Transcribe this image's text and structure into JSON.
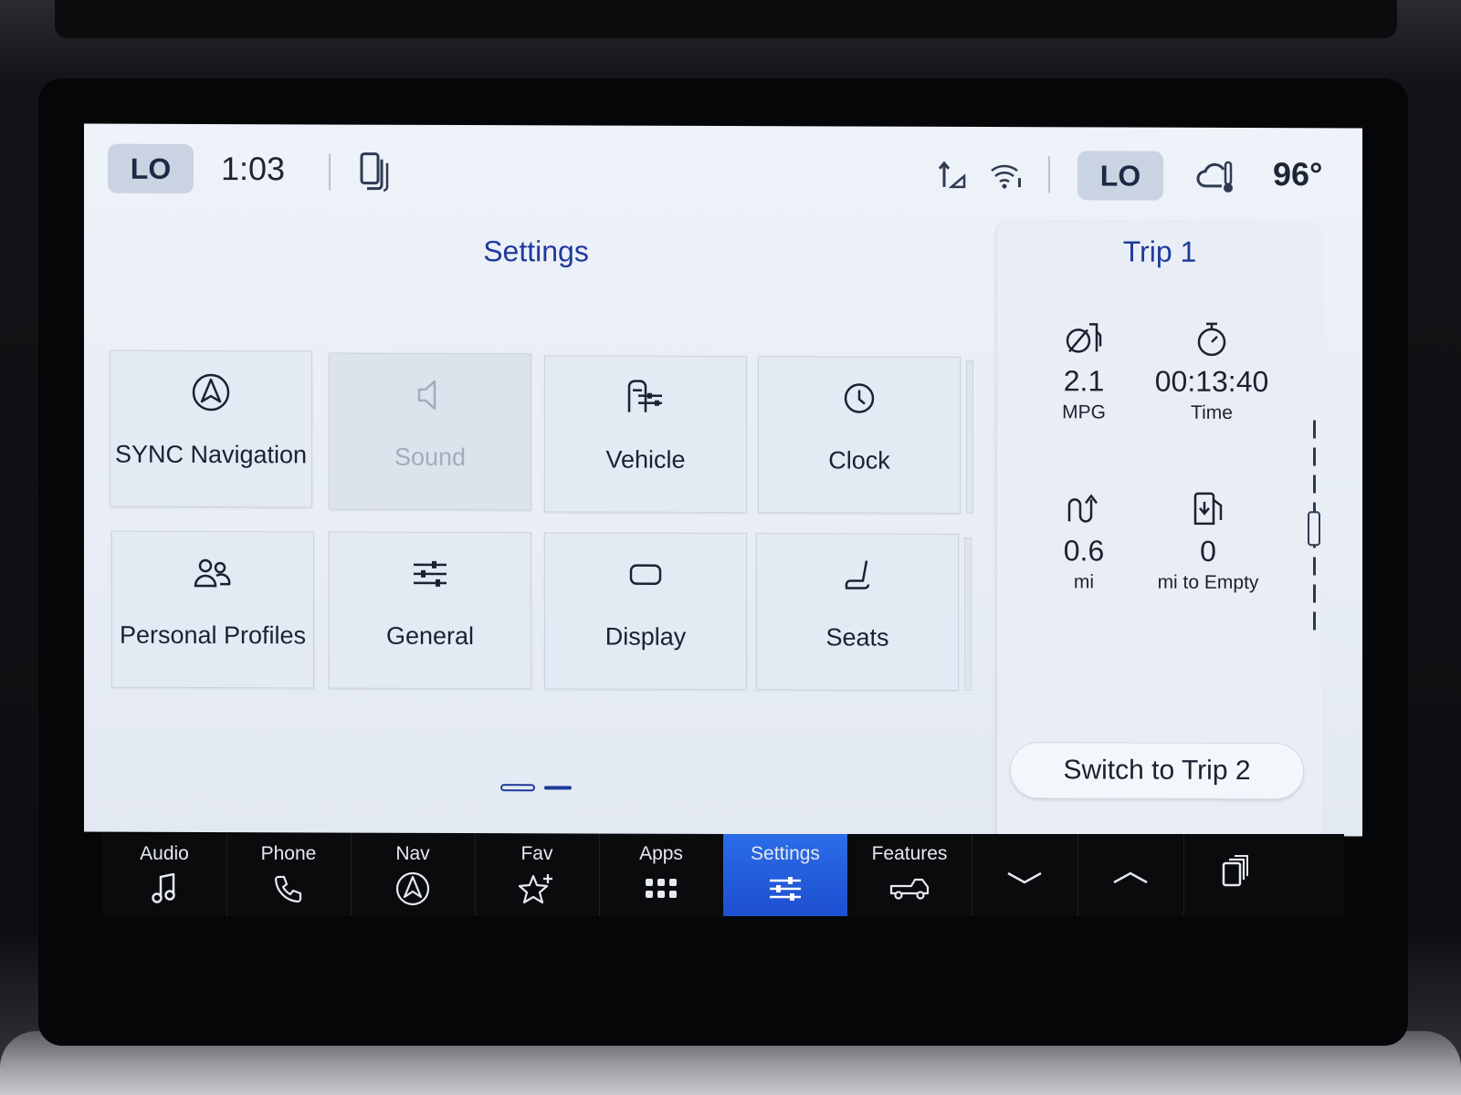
{
  "status_bar": {
    "left_temp": "LO",
    "time": "1:03",
    "right_temp": "LO",
    "outside_temp": "96°"
  },
  "page": {
    "title": "Settings"
  },
  "tiles": [
    {
      "label": "SYNC Navigation",
      "icon": "navigation-icon",
      "enabled": true
    },
    {
      "label": "Sound",
      "icon": "speaker-icon",
      "enabled": false
    },
    {
      "label": "Vehicle",
      "icon": "vehicle-settings-icon",
      "enabled": true
    },
    {
      "label": "Clock",
      "icon": "clock-icon",
      "enabled": true
    },
    {
      "label": "Personal Profiles",
      "icon": "profiles-icon",
      "enabled": true
    },
    {
      "label": "General",
      "icon": "sliders-icon",
      "enabled": true
    },
    {
      "label": "Display",
      "icon": "display-icon",
      "enabled": true
    },
    {
      "label": "Seats",
      "icon": "seat-icon",
      "enabled": true
    }
  ],
  "pager": {
    "current": 1,
    "total": 2
  },
  "trip": {
    "title": "Trip 1",
    "metrics": [
      {
        "value": "2.1",
        "unit": "MPG",
        "icon": "fuel-economy-icon"
      },
      {
        "value": "00:13:40",
        "unit": "Time",
        "icon": "stopwatch-icon"
      },
      {
        "value": "0.6",
        "unit": "mi",
        "icon": "distance-icon"
      },
      {
        "value": "0",
        "unit": "mi to Empty",
        "icon": "fuel-pump-icon"
      }
    ],
    "switch_label": "Switch to Trip 2"
  },
  "dock": {
    "items": [
      {
        "label": "Audio",
        "icon": "music-note-icon"
      },
      {
        "label": "Phone",
        "icon": "phone-icon"
      },
      {
        "label": "Nav",
        "icon": "navigation-icon"
      },
      {
        "label": "Fav",
        "icon": "star-plus-icon"
      },
      {
        "label": "Apps",
        "icon": "apps-grid-icon"
      },
      {
        "label": "Settings",
        "icon": "sliders-icon",
        "active": true
      },
      {
        "label": "Features",
        "icon": "truck-icon"
      }
    ]
  },
  "colors": {
    "accent": "#1f3a9b",
    "active_tab": "#2563eb",
    "screen_bg": "#e9eef6"
  }
}
